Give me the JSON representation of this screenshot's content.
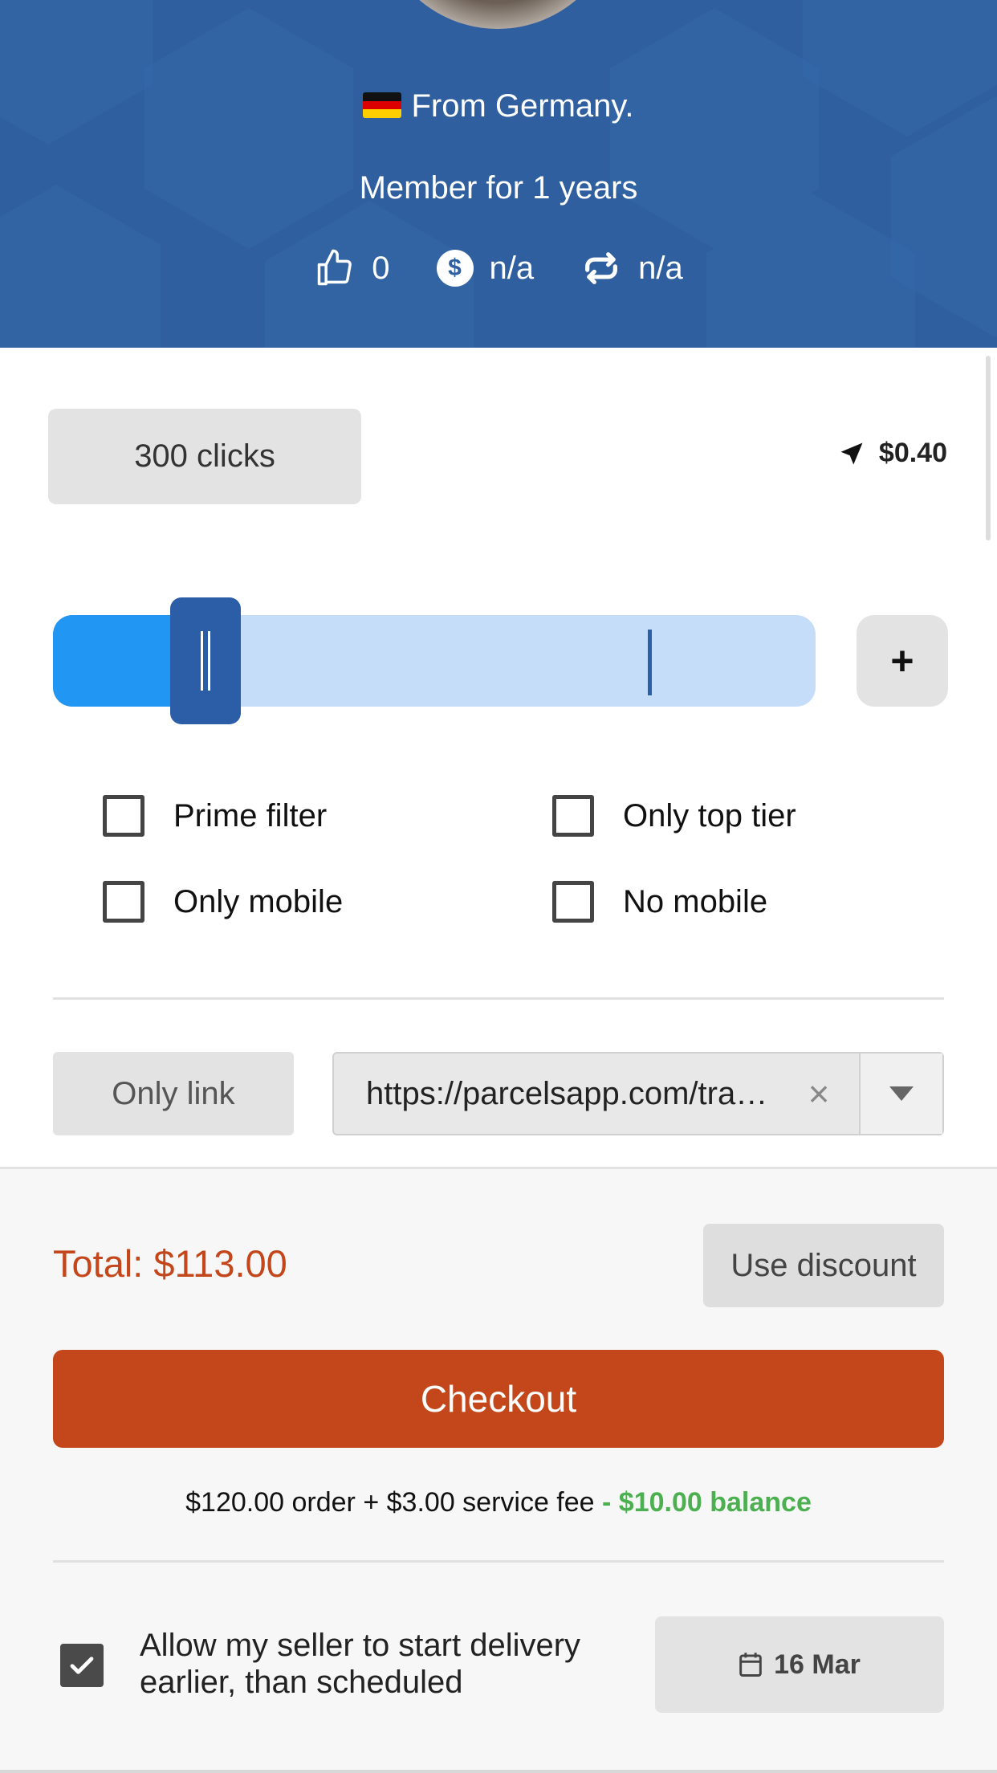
{
  "profile": {
    "country_text": "From Germany.",
    "member_text": "Member for 1 years",
    "stats": {
      "likes": "0",
      "earnings": "n/a",
      "repeat": "n/a"
    }
  },
  "offer": {
    "clicks_label": "300 clicks",
    "price": "$0.40",
    "slider_value_fraction": 0.2,
    "slider_marker_fraction": 0.78,
    "plus_label": "+"
  },
  "filters": {
    "prime_filter": "Prime filter",
    "only_top_tier": "Only top tier",
    "only_mobile": "Only mobile",
    "no_mobile": "No mobile"
  },
  "link": {
    "only_link_label": "Only link",
    "url_value": "https://parcelsapp.com/tracking",
    "clear_icon": "×"
  },
  "checkout": {
    "total_label": "Total: $113.00",
    "discount_label": "Use discount",
    "checkout_label": "Checkout",
    "order_text": "$120.00 order",
    "plus_sign": "+",
    "fee_text": "$3.00 service fee",
    "balance_text": "- $10.00 balance",
    "allow_text": "Allow my seller to start delivery earlier, than scheduled",
    "allow_checked": true,
    "date_label": "16 Mar"
  },
  "colors": {
    "header_bg": "#2f5f9f",
    "slider_fill": "#2196f3",
    "slider_track": "#c5ddf8",
    "accent": "#c4471b",
    "balance": "#4caf50"
  }
}
